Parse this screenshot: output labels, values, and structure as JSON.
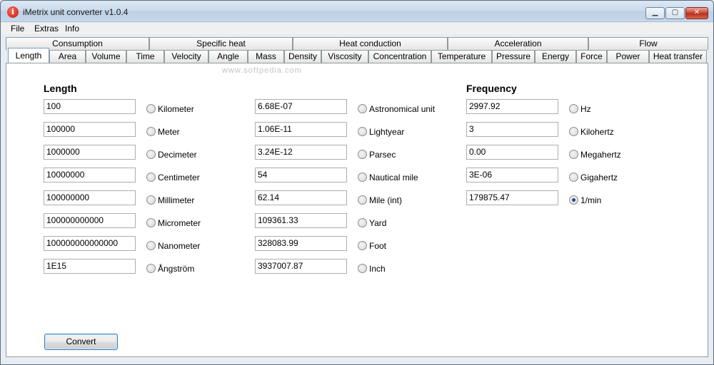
{
  "window": {
    "title": "iMetrix unit converter v1.0.4",
    "min_glyph": "▁",
    "max_glyph": "▢",
    "close_glyph": "✕"
  },
  "menu": [
    "File",
    "Extras",
    "Info"
  ],
  "tabs_top": [
    "Consumption",
    "Specific heat",
    "Heat conduction",
    "Acceleration",
    "Flow"
  ],
  "tabs_bottom": [
    "Length",
    "Area",
    "Volume",
    "Time",
    "Velocity",
    "Angle",
    "Mass",
    "Density",
    "Viscosity",
    "Concentration",
    "Temperature",
    "Pressure",
    "Energy",
    "Force",
    "Power",
    "Heat transfer"
  ],
  "active_tab": "Length",
  "watermark": "www.softpedia.com",
  "length": {
    "heading": "Length",
    "rows": [
      {
        "value": "100",
        "unit": "Kilometer"
      },
      {
        "value": "100000",
        "unit": "Meter"
      },
      {
        "value": "1000000",
        "unit": "Decimeter"
      },
      {
        "value": "10000000",
        "unit": "Centimeter"
      },
      {
        "value": "100000000",
        "unit": "Millimeter"
      },
      {
        "value": "100000000000",
        "unit": "Micrometer"
      },
      {
        "value": "100000000000000",
        "unit": "Nanometer"
      },
      {
        "value": "1E15",
        "unit": "Ångström"
      }
    ],
    "rows2": [
      {
        "value": "6.68E-07",
        "unit": "Astronomical unit"
      },
      {
        "value": "1.06E-11",
        "unit": "Lightyear"
      },
      {
        "value": "3.24E-12",
        "unit": "Parsec"
      },
      {
        "value": "54",
        "unit": "Nautical mile"
      },
      {
        "value": "62.14",
        "unit": "Mile (int)"
      },
      {
        "value": "109361.33",
        "unit": "Yard"
      },
      {
        "value": "328083.99",
        "unit": "Foot"
      },
      {
        "value": "3937007.87",
        "unit": "Inch"
      }
    ]
  },
  "frequency": {
    "heading": "Frequency",
    "rows": [
      {
        "value": "2997.92",
        "unit": "Hz",
        "checked": false
      },
      {
        "value": "3",
        "unit": "Kilohertz",
        "checked": false
      },
      {
        "value": "0.00",
        "unit": "Megahertz",
        "checked": false
      },
      {
        "value": "3E-06",
        "unit": "Gigahertz",
        "checked": false
      },
      {
        "value": "179875.47",
        "unit": "1/min",
        "checked": true
      }
    ]
  },
  "convert_label": "Convert"
}
